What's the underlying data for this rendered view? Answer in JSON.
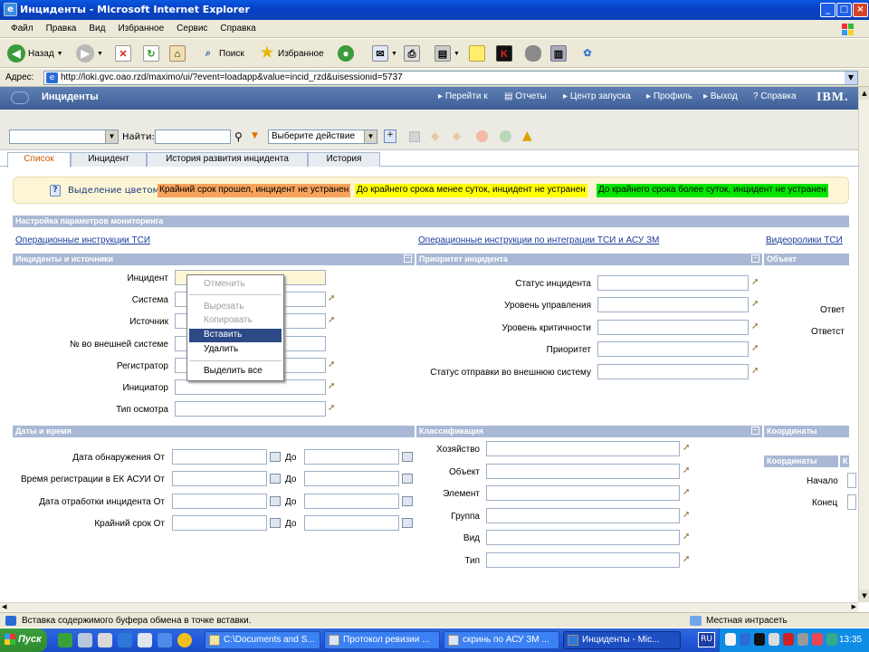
{
  "window": {
    "title": "Инциденты - Microsoft Internet Explorer"
  },
  "menu": [
    "Файл",
    "Правка",
    "Вид",
    "Избранное",
    "Сервис",
    "Справка"
  ],
  "toolbar": {
    "back": "Назад",
    "search": "Поиск",
    "favorites": "Избранное"
  },
  "address": {
    "label": "Адрес:",
    "url": "http://loki.gvc.oao.rzd/maximo/ui/?event=loadapp&value=incid_rzd&uisessionid=5737"
  },
  "app": {
    "title": "Инциденты",
    "nav": [
      "Перейти к",
      "Отчеты",
      "Центр запуска",
      "Профиль",
      "Выход",
      "Справка"
    ],
    "brand": "IBM."
  },
  "searchbar": {
    "find_label": "Найти:",
    "action_select": "Выберите действие"
  },
  "tabs": [
    "Список",
    "Инцидент",
    "История развития инцидента",
    "История"
  ],
  "legend": {
    "label": "Выделение цветом:",
    "items": [
      {
        "text": "Крайний срок прошел, инцидент не устранен",
        "color": "#f7a35c"
      },
      {
        "text": "До крайнего срока менее суток, инцидент не устранен",
        "color": "#ffff00"
      },
      {
        "text": "До крайнего срока более суток, инцидент не устранен",
        "color": "#00e600"
      }
    ]
  },
  "sections": {
    "monitoring": "Настройка параметров мониторинга",
    "incidents_sources": "Инциденты и источники",
    "priority": "Приоритет инцидента",
    "object": "Объект",
    "dates": "Даты и время",
    "classification": "Классификация",
    "coordinates": "Координаты",
    "coordinates_sub": "Координаты",
    "coordinates_sub2": "К"
  },
  "links": [
    "Операционные инструкции ТСИ",
    "Операционные инструкции по интеграции ТСИ и АСУ ЗМ",
    "Видеоролики ТСИ"
  ],
  "incident_fields": [
    "Инцидент",
    "Система",
    "Источник",
    "№ во внешней системе",
    "Регистратор",
    "Инициатор",
    "Тип осмотра"
  ],
  "priority_fields": [
    "Статус инцидента",
    "Уровень управления",
    "Уровень критичности",
    "Приоритет",
    "Статус отправки во внешнюю систему"
  ],
  "object_fields": [
    "Ответ",
    "Ответст"
  ],
  "date_fields": [
    "Дата обнаружения От",
    "Время регистрации в ЕК АСУИ От",
    "Дата отработки инцидента От",
    "Крайний срок От"
  ],
  "date_to": "До",
  "class_fields": [
    "Хозяйство",
    "Объект",
    "Элемент",
    "Группа",
    "Вид",
    "Тип"
  ],
  "coord_fields": [
    "Начало",
    "Конец"
  ],
  "context_menu": {
    "items": [
      {
        "label": "Отменить",
        "enabled": false
      },
      {
        "label": "Вырезать",
        "enabled": false
      },
      {
        "label": "Копировать",
        "enabled": false
      },
      {
        "label": "Вставить",
        "enabled": true,
        "highlighted": true
      },
      {
        "label": "Удалить",
        "enabled": true
      },
      {
        "label": "Выделить все",
        "enabled": true
      }
    ]
  },
  "status": {
    "text": "Вставка содержимого буфера обмена в точке вставки.",
    "zone": "Местная интрасеть"
  },
  "taskbar": {
    "start": "Пуск",
    "tasks": [
      "C:\\Documents and S...",
      "Протокол ревизии ...",
      "скринь по АСУ ЗМ ...",
      "Инциденты - Mic..."
    ],
    "lang": "RU",
    "clock": "13:35"
  }
}
